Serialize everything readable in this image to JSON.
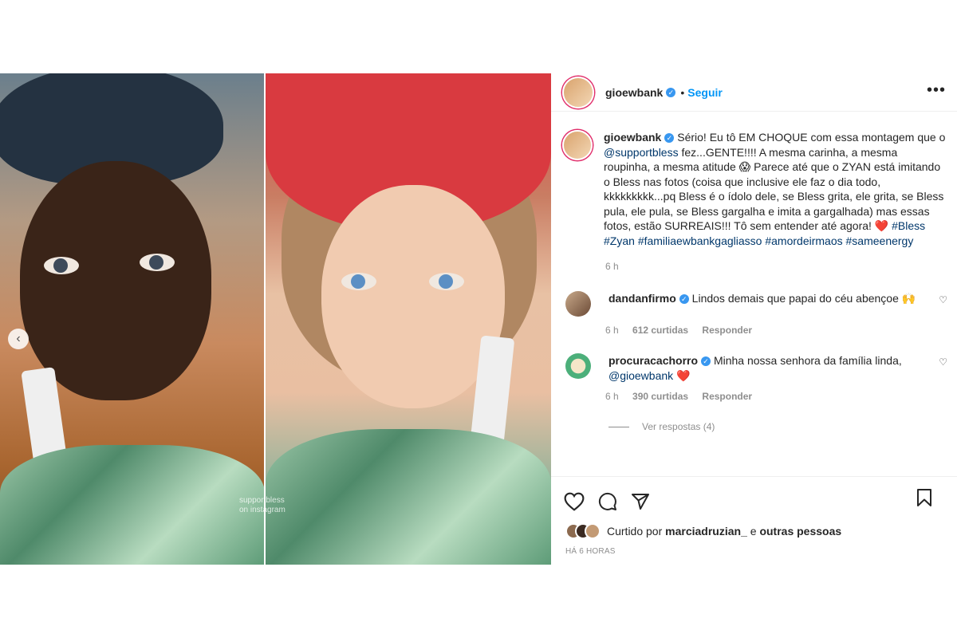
{
  "post": {
    "username": "gioewbank",
    "separator": "•",
    "follow_label": "Seguir",
    "more_label": "•••",
    "watermark_line1": "supportbless",
    "watermark_line2": "on instagram",
    "nav_arrow": "‹",
    "brand_color": "#0095f6"
  },
  "caption": {
    "username": "gioewbank",
    "text_part1": "Sério! Eu tô EM CHOQUE com essa montagem que o ",
    "mention": "@supportbless",
    "text_part2": " fez...GENTE!!!! A mesma carinha, a mesma roupinha, a mesma atitude 😱 Parece até que o ZYAN está imitando o Bless nas fotos (coisa que inclusive ele faz o dia todo, kkkkkkkkk...pq Bless é o ídolo dele, se Bless grita, ele grita, se Bless pula, ele pula, se Bless gargalha e imita a gargalhada) mas essas fotos, estão SURREAIS!!! Tô sem entender até agora! ❤️ ",
    "hashtag1": "#Bless",
    "hashtag2": "#Zyan",
    "hashtag3": "#familiaewbankgagliasso",
    "hashtag4": "#amordeirmaos",
    "hashtag5": "#sameenergy",
    "time": "6 h"
  },
  "comments": [
    {
      "username": "dandanfirmo",
      "text": "Lindos demais que papai do céu abençoe 🙌",
      "time": "6 h",
      "likes": "612 curtidas",
      "reply_label": "Responder"
    },
    {
      "username": "procuracachorro",
      "text": "Minha nossa senhora da família linda, ",
      "mention": "@gioewbank",
      "emoji": " ❤️",
      "time": "6 h",
      "likes": "390 curtidas",
      "reply_label": "Responder",
      "replies_label": "Ver respostas (4)"
    }
  ],
  "actions": {
    "liked_by_prefix": "Curtido por ",
    "liked_by_user": "marciadruzian_",
    "liked_by_and": " e ",
    "liked_by_others": "outras pessoas",
    "posted_ago": "HÁ 6 HORAS",
    "add_comment_symbol": "+"
  }
}
